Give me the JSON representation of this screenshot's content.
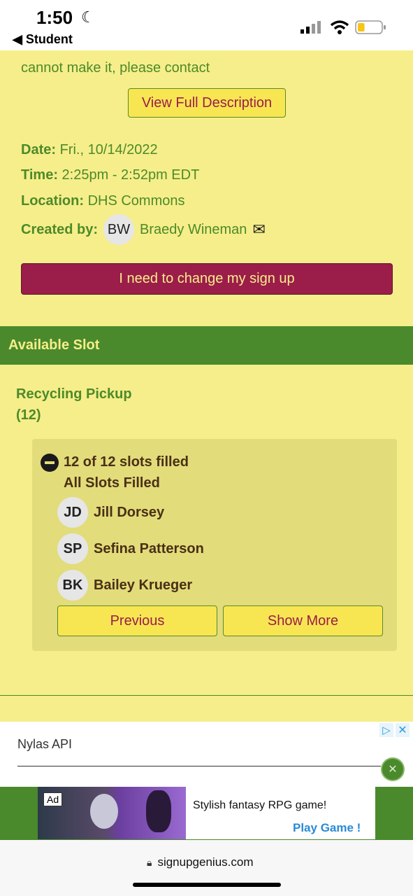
{
  "status_bar": {
    "time": "1:50",
    "back_label": "Student",
    "battery_level": 0.3
  },
  "description": {
    "line1": "cannot make it, please contact",
    "view_button": "View Full Description"
  },
  "details": {
    "date_label": "Date:",
    "date_value": "Fri., 10/14/2022",
    "time_label": "Time:",
    "time_value": "2:25pm - 2:52pm EDT",
    "location_label": "Location:",
    "location_value": "DHS Commons",
    "created_label": "Created by:",
    "creator_initials": "BW",
    "creator_name": "Braedy Wineman"
  },
  "change_button": "I need to change my sign up",
  "available_slot_header": "Available Slot",
  "item": {
    "title": "Recycling Pickup",
    "count": "(12)"
  },
  "slot_box": {
    "filled_text": "12 of 12 slots filled",
    "status_text": "All Slots Filled",
    "people": [
      {
        "initials": "JD",
        "name": "Jill Dorsey"
      },
      {
        "initials": "SP",
        "name": "Sefina Patterson"
      },
      {
        "initials": "BK",
        "name": "Bailey Krueger"
      }
    ],
    "previous_label": "Previous",
    "show_more_label": "Show More"
  },
  "ad": {
    "title": "Nylas API",
    "badge": "Ad",
    "banner_text": "Stylish fantasy RPG game!",
    "cta": "Play Game !"
  },
  "url_bar": {
    "domain": "signupgenius.com"
  },
  "colors": {
    "page_bg": "#f6ee8a",
    "green": "#4a8a2c",
    "maroon": "#9b1d4a",
    "slot_box": "#e2dc7a"
  }
}
